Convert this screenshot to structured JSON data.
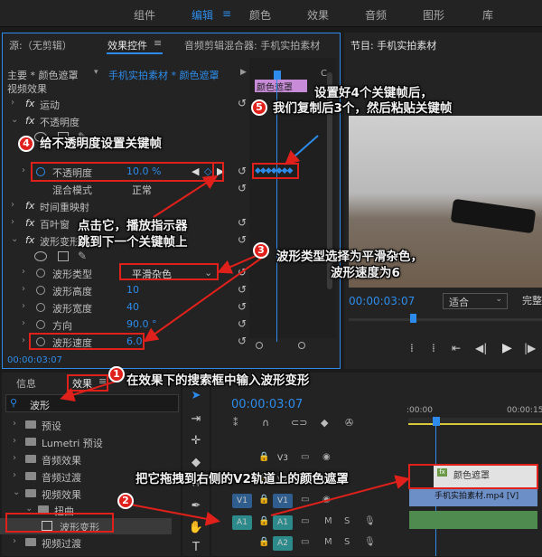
{
  "workspaces": [
    "组件",
    "编辑",
    "颜色",
    "效果",
    "音频",
    "图形",
    "库"
  ],
  "active_workspace": "编辑",
  "effect_controls": {
    "tabs": {
      "source": "源:（无剪辑）",
      "effect_controls": "效果控件",
      "audio_mixer": "音频剪辑混合器: 手机实拍素材"
    },
    "clip_master": "主要 * 颜色遮罩",
    "clip_seq": "手机实拍素材 * 颜色遮罩",
    "clip_label": "颜色遮罩",
    "video_effects_label": "视频效果",
    "motion": "运动",
    "opacity": "不透明度",
    "opacity_prop": "不透明度",
    "opacity_value": "10.0 %",
    "blend_mode_label": "混合模式",
    "blend_mode_value": "正常",
    "time_remap": "时间重映射",
    "louver": "百叶窗",
    "wave_warp": "波形变形",
    "wave_type_label": "波形类型",
    "wave_type_value": "平滑杂色",
    "wave_height_label": "波形高度",
    "wave_height_value": "10",
    "wave_width_label": "波形宽度",
    "wave_width_value": "40",
    "direction_label": "方向",
    "direction_value": "90.0 °",
    "wave_speed_label": "波形速度",
    "wave_speed_value": "6.0",
    "timecode": "00:00:03:07"
  },
  "program": {
    "title": "节目: 手机实拍素材",
    "timecode": "00:00:03:07",
    "fit": "适合",
    "full": "完整"
  },
  "effects_panel": {
    "tab_info": "信息",
    "tab_effects": "效果",
    "search_value": "波形",
    "items": [
      "预设",
      "Lumetri 预设",
      "音频效果",
      "音频过渡",
      "视频效果",
      "扭曲",
      "波形变形",
      "视频过渡"
    ]
  },
  "timeline": {
    "timecode": "00:00:03:07",
    "ruler_start": ":00:00",
    "ruler_end": "00:00:15",
    "tracks": [
      "V3",
      "V2",
      "V1",
      "A1",
      "A2"
    ],
    "source_v1": "V1",
    "source_a1": "A1",
    "clip_matte": "颜色遮罩",
    "clip_video": "手机实拍素材.mp4 [V]"
  },
  "annotations": {
    "a1": "在效果下的搜索框中输入波形变形",
    "a2": "把它拖拽到右侧的V2轨道上的颜色遮罩",
    "a3_line1": "波形类型选择为平滑杂色，",
    "a3_line2": "波形速度为6",
    "a4": "给不透明度设置关键帧",
    "a5_line1": "设置好4个关键帧后，",
    "a5_line2": "我们复制后3个，然后粘贴关键帧",
    "click_line1": "点击它，播放指示器",
    "click_line2": "跳到下一个关键帧上",
    "n1": "1",
    "n2": "2",
    "n3": "3",
    "n4": "4",
    "n5": "5"
  }
}
